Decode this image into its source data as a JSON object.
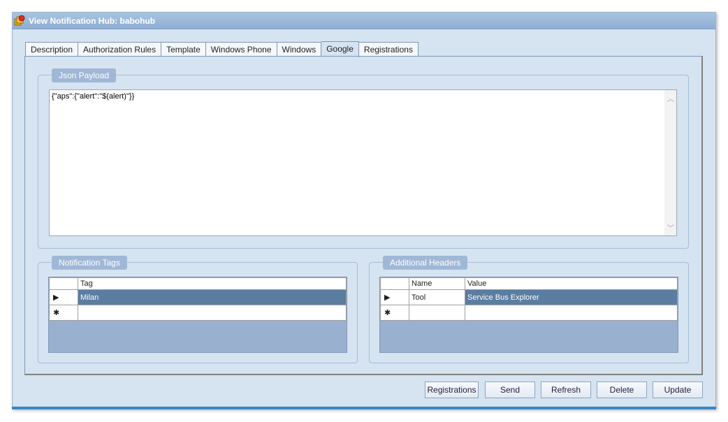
{
  "window": {
    "title": "View Notification Hub: babohub"
  },
  "tabs": [
    "Description",
    "Authorization Rules",
    "Template",
    "Windows Phone",
    "Windows",
    "Google",
    "Registrations"
  ],
  "active_tab": "Google",
  "json_payload": {
    "label": "Json Payload",
    "value": "{\"aps\":{\"alert\":\"$(alert)\"}}"
  },
  "notification_tags": {
    "label": "Notification Tags",
    "columns": [
      "Tag"
    ],
    "rows": [
      {
        "marker": "▶",
        "tag": "Milan"
      }
    ],
    "new_row_marker": "✱"
  },
  "additional_headers": {
    "label": "Additional Headers",
    "columns": [
      "Name",
      "Value"
    ],
    "rows": [
      {
        "marker": "▶",
        "name": "Tool",
        "value": "Service Bus Explorer"
      }
    ],
    "new_row_marker": "✱"
  },
  "buttons": {
    "registrations": "Registrations",
    "send": "Send",
    "refresh": "Refresh",
    "delete": "Delete",
    "update": "Update"
  },
  "colors": {
    "accent": "#3a86c6",
    "selected_row": "#5a7da0",
    "group_title_bg": "#a0b8d6"
  }
}
